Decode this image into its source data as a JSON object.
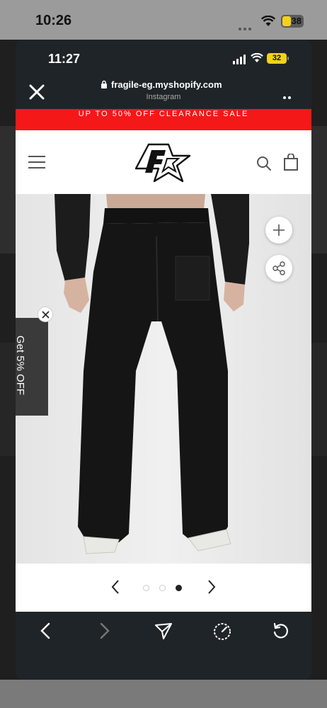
{
  "outer_status": {
    "time": "10:26",
    "battery": "38"
  },
  "inner_status": {
    "time": "11:27",
    "battery": "32"
  },
  "browser": {
    "url": "fragile-eg.myshopify.com",
    "source": "Instagram"
  },
  "store": {
    "banner": "UP TO 50% OFF CLEARANCE SALE",
    "promo": "Get 5% OFF"
  },
  "carousel": {
    "slide_count": 3,
    "active_index": 2
  },
  "colors": {
    "banner_red": "#f41818",
    "chrome_dark": "#1f2428",
    "battery_yellow": "#f2d21a"
  }
}
